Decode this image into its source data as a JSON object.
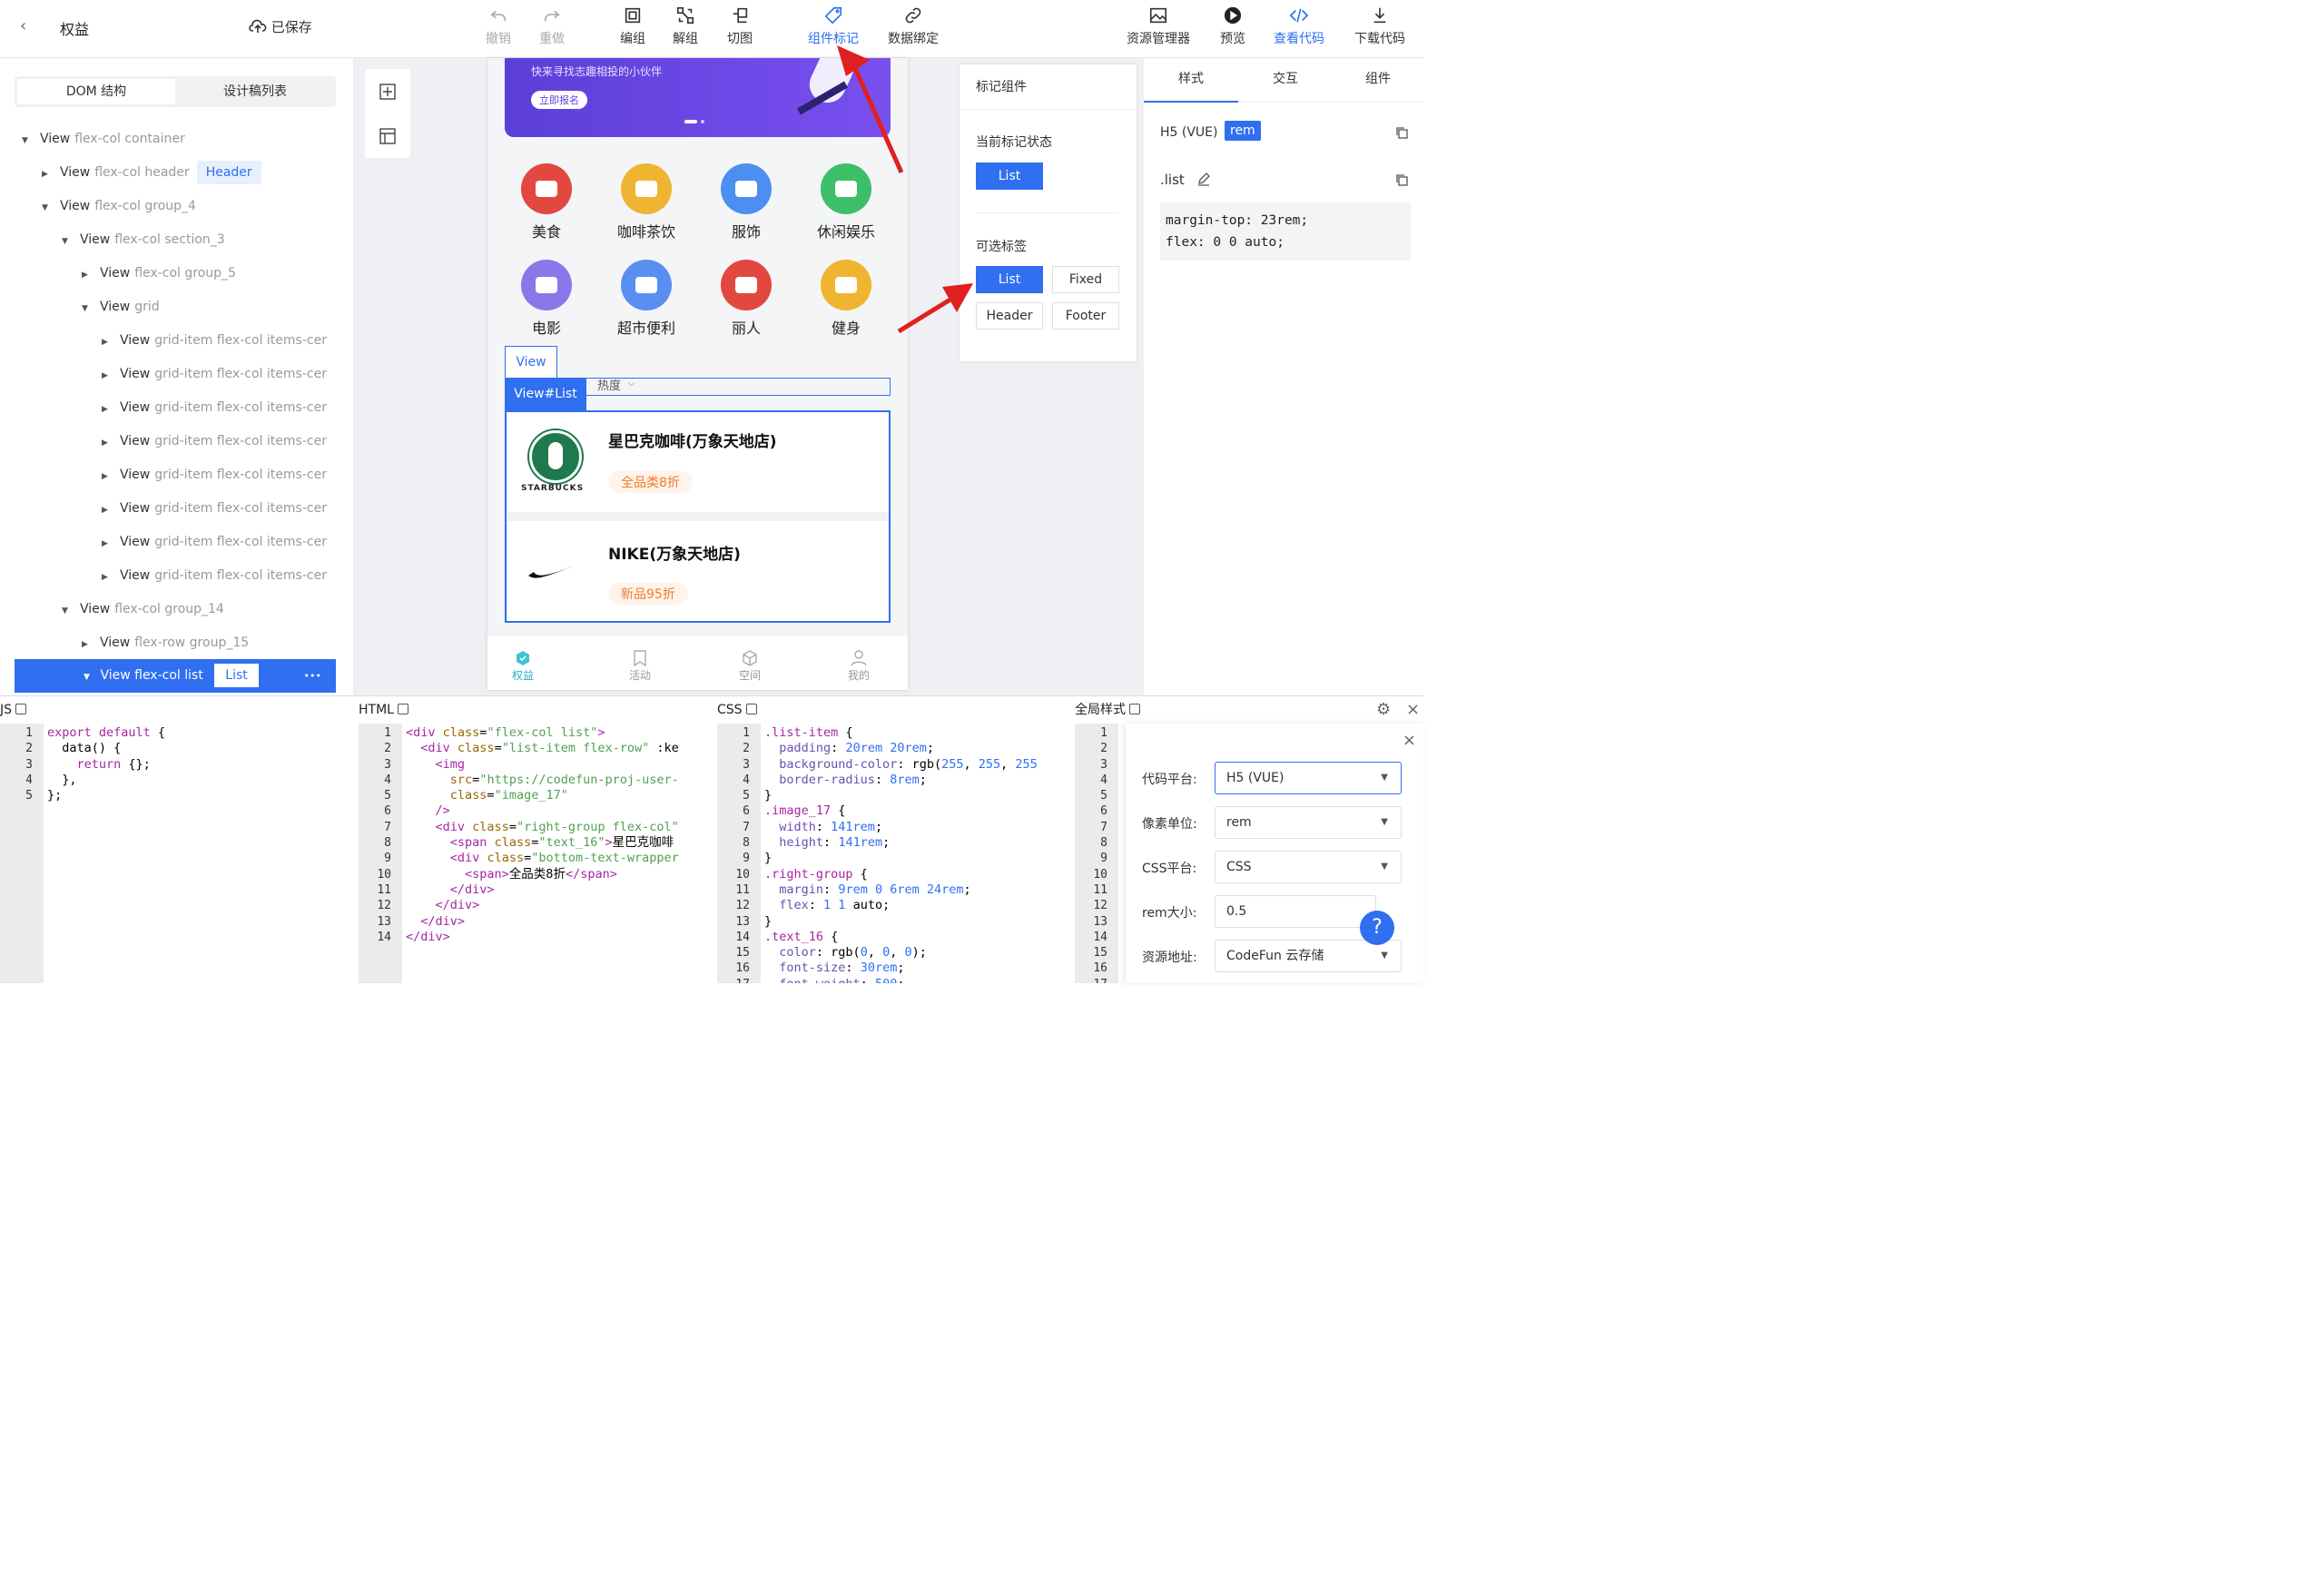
{
  "topbar": {
    "back_label": "<",
    "project_title": "权益",
    "saved_label": "已保存",
    "tools": [
      "撤销",
      "重做",
      "编组",
      "解组",
      "切图",
      "组件标记",
      "数据绑定"
    ],
    "right_tools": [
      "资源管理器",
      "预览",
      "查看代码",
      "下载代码"
    ]
  },
  "left": {
    "tabs": [
      "DOM 结构",
      "设计稿列表"
    ],
    "tree": [
      {
        "indent": 0,
        "arrow": "down",
        "type": "View",
        "cls": "flex-col container"
      },
      {
        "indent": 1,
        "arrow": "right",
        "type": "View",
        "cls": "flex-col header",
        "tag": "Header"
      },
      {
        "indent": 1,
        "arrow": "down",
        "type": "View",
        "cls": "flex-col group_4"
      },
      {
        "indent": 2,
        "arrow": "down",
        "type": "View",
        "cls": "flex-col section_3"
      },
      {
        "indent": 3,
        "arrow": "right",
        "type": "View",
        "cls": "flex-col group_5"
      },
      {
        "indent": 3,
        "arrow": "down",
        "type": "View",
        "cls": "grid"
      },
      {
        "indent": 4,
        "arrow": "right",
        "type": "View",
        "cls": "grid-item flex-col items-cer"
      },
      {
        "indent": 4,
        "arrow": "right",
        "type": "View",
        "cls": "grid-item flex-col items-cer"
      },
      {
        "indent": 4,
        "arrow": "right",
        "type": "View",
        "cls": "grid-item flex-col items-cer"
      },
      {
        "indent": 4,
        "arrow": "right",
        "type": "View",
        "cls": "grid-item flex-col items-cer"
      },
      {
        "indent": 4,
        "arrow": "right",
        "type": "View",
        "cls": "grid-item flex-col items-cer"
      },
      {
        "indent": 4,
        "arrow": "right",
        "type": "View",
        "cls": "grid-item flex-col items-cer"
      },
      {
        "indent": 4,
        "arrow": "right",
        "type": "View",
        "cls": "grid-item flex-col items-cer"
      },
      {
        "indent": 4,
        "arrow": "right",
        "type": "View",
        "cls": "grid-item flex-col items-cer"
      },
      {
        "indent": 2,
        "arrow": "down",
        "type": "View",
        "cls": "flex-col group_14"
      },
      {
        "indent": 3,
        "arrow": "right",
        "type": "View",
        "cls": "flex-row group_15"
      }
    ],
    "selected": {
      "label": "View flex-col list",
      "tag": "List",
      "more": "•••"
    }
  },
  "phone": {
    "banner_text": "快来寻找志趣相投的小伙伴",
    "banner_button": "立即报名",
    "categories": [
      "美食",
      "咖啡茶饮",
      "服饰",
      "休闲娱乐",
      "电影",
      "超市便利",
      "丽人",
      "健身"
    ],
    "category_colors": [
      "#e2483f",
      "#efb431",
      "#4d8ff0",
      "#3dbf6a",
      "#8a78ea",
      "#5a8ff2",
      "#e2483f",
      "#f0b530"
    ],
    "view_label": "View",
    "list_label": "View#List",
    "sort_label": "热度",
    "stores": [
      {
        "name": "星巴克咖啡(万象天地店)",
        "badge": "全品类8折",
        "logo": "STARBUCKS"
      },
      {
        "name": "NIKE(万象天地店)",
        "badge": "新品95折",
        "logo": ""
      }
    ],
    "tabs": [
      "权益",
      "活动",
      "空间",
      "我的"
    ]
  },
  "mark": {
    "title": "标记组件",
    "current_label": "当前标记状态",
    "current_value": "List",
    "options_label": "可选标签",
    "options": [
      "List",
      "Fixed",
      "Header",
      "Footer"
    ]
  },
  "right": {
    "tabs": [
      "样式",
      "交互",
      "组件"
    ],
    "platform": "H5 (VUE)",
    "unit_badge": "rem",
    "selector": ".list",
    "code": [
      "margin-top: 23rem;",
      "flex: 0 0 auto;"
    ]
  },
  "bottom": {
    "panels": [
      "JS",
      "HTML",
      "CSS",
      "全局样式"
    ],
    "js_lines": 5,
    "html_lines": 14,
    "css_lines": 17,
    "global_lines": 17
  },
  "settings": {
    "rows": [
      {
        "label": "代码平台:",
        "value": "H5 (VUE)"
      },
      {
        "label": "像素单位:",
        "value": "rem"
      },
      {
        "label": "CSS平台:",
        "value": "CSS"
      },
      {
        "label": "rem大小:",
        "value": "0.5"
      },
      {
        "label": "资源地址:",
        "value": "CodeFun 云存储"
      }
    ],
    "help": "?"
  },
  "colors": {
    "accent": "#2f6ff0",
    "arrow": "#e02020",
    "orange": "#f07b2a"
  }
}
